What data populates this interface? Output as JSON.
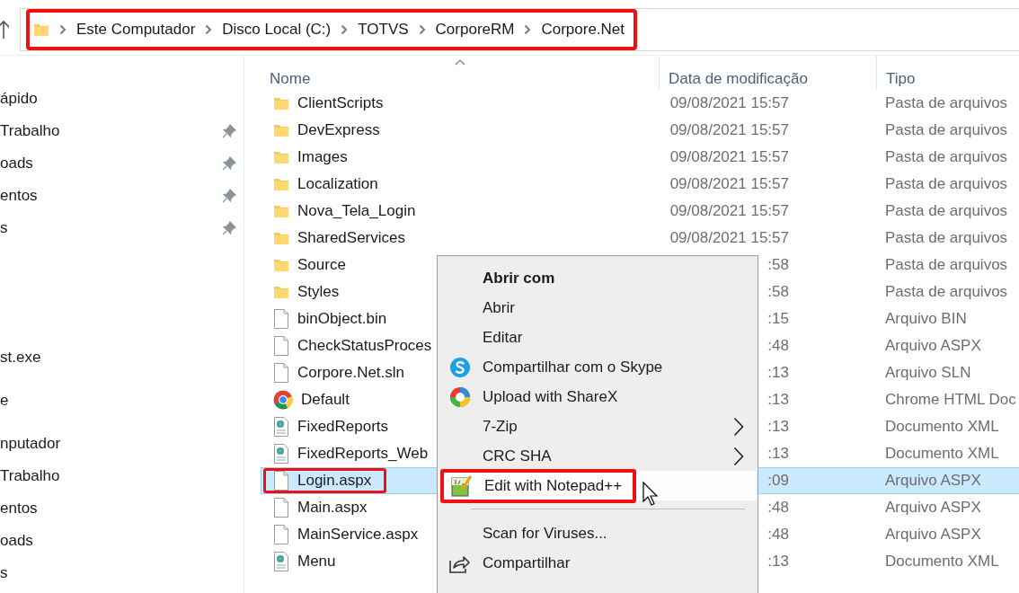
{
  "address_bar": {
    "marked": true,
    "crumbs": [
      "Este Computador",
      "Disco Local (C:)",
      "TOTVS",
      "CorporeRM",
      "Corpore.Net"
    ]
  },
  "sidebar": {
    "groups": [
      {
        "items": [
          {
            "label": "ápido",
            "pinned": false
          },
          {
            "label": "Trabalho",
            "pinned": true
          },
          {
            "label": "oads",
            "pinned": true
          },
          {
            "label": "entos",
            "pinned": true
          },
          {
            "label": "s",
            "pinned": true
          }
        ]
      },
      {
        "items": [
          {
            "label": "st.exe",
            "pinned": false
          }
        ]
      },
      {
        "items": [
          {
            "label": "e",
            "pinned": false
          }
        ]
      },
      {
        "items": [
          {
            "label": "nputador",
            "pinned": false
          },
          {
            "label": "Trabalho",
            "pinned": false
          },
          {
            "label": "entos",
            "pinned": false
          },
          {
            "label": "oads",
            "pinned": false
          },
          {
            "label": "s",
            "pinned": false
          }
        ]
      }
    ]
  },
  "file_list": {
    "columns": [
      "Nome",
      "Data de modificação",
      "Tipo"
    ],
    "rows": [
      {
        "kind": "folder",
        "name": "ClientScripts",
        "date": "09/08/2021 15:57",
        "type": "Pasta de arquivos",
        "selected": false,
        "marked": false
      },
      {
        "kind": "folder",
        "name": "DevExpress",
        "date": "09/08/2021 15:57",
        "type": "Pasta de arquivos",
        "selected": false,
        "marked": false
      },
      {
        "kind": "folder",
        "name": "Images",
        "date": "09/08/2021 15:57",
        "type": "Pasta de arquivos",
        "selected": false,
        "marked": false
      },
      {
        "kind": "folder",
        "name": "Localization",
        "date": "09/08/2021 15:57",
        "type": "Pasta de arquivos",
        "selected": false,
        "marked": false
      },
      {
        "kind": "folder",
        "name": "Nova_Tela_Login",
        "date": "09/08/2021 15:57",
        "type": "Pasta de arquivos",
        "selected": false,
        "marked": false
      },
      {
        "kind": "folder",
        "name": "SharedServices",
        "date": "09/08/2021 15:57",
        "type": "Pasta de arquivos",
        "selected": false,
        "marked": false
      },
      {
        "kind": "folder",
        "name": "Source",
        "date": ":58",
        "type": "Pasta de arquivos",
        "selected": false,
        "marked": false
      },
      {
        "kind": "folder",
        "name": "Styles",
        "date": ":58",
        "type": "Pasta de arquivos",
        "selected": false,
        "marked": false
      },
      {
        "kind": "file",
        "name": "binObject.bin",
        "date": ":15",
        "type": "Arquivo BIN",
        "selected": false,
        "marked": false
      },
      {
        "kind": "file",
        "name": "CheckStatusProces",
        "date": ":48",
        "type": "Arquivo ASPX",
        "selected": false,
        "marked": false
      },
      {
        "kind": "file",
        "name": "Corpore.Net.sln",
        "date": ":13",
        "type": "Arquivo SLN",
        "selected": false,
        "marked": false
      },
      {
        "kind": "chrome",
        "name": "Default",
        "date": ":13",
        "type": "Chrome HTML Doc",
        "selected": false,
        "marked": false
      },
      {
        "kind": "xml",
        "name": "FixedReports",
        "date": ":13",
        "type": "Documento XML",
        "selected": false,
        "marked": false
      },
      {
        "kind": "xml",
        "name": "FixedReports_Web",
        "date": ":13",
        "type": "Documento XML",
        "selected": false,
        "marked": false
      },
      {
        "kind": "file",
        "name": "Login.aspx",
        "date": ":09",
        "type": "Arquivo ASPX",
        "selected": true,
        "marked": true
      },
      {
        "kind": "file",
        "name": "Main.aspx",
        "date": ":48",
        "type": "Arquivo ASPX",
        "selected": false,
        "marked": false
      },
      {
        "kind": "file",
        "name": "MainService.aspx",
        "date": ":48",
        "type": "Arquivo ASPX",
        "selected": false,
        "marked": false
      },
      {
        "kind": "xml",
        "name": "Menu",
        "date": ":13",
        "type": "Documento XML",
        "selected": false,
        "marked": false
      }
    ]
  },
  "context_menu": {
    "items": [
      {
        "kind": "header",
        "label": "Abrir com",
        "selected": false,
        "marked": false
      },
      {
        "kind": "plain",
        "label": "Abrir",
        "selected": false,
        "marked": false
      },
      {
        "kind": "plain",
        "label": "Editar",
        "selected": false,
        "marked": false
      },
      {
        "kind": "skype",
        "label": "Compartilhar com o Skype",
        "selected": false,
        "marked": false
      },
      {
        "kind": "sharex",
        "label": "Upload with ShareX",
        "selected": false,
        "marked": false
      },
      {
        "kind": "submenu",
        "label": "7-Zip",
        "selected": false,
        "marked": false
      },
      {
        "kind": "submenu",
        "label": "CRC SHA",
        "selected": false,
        "marked": false
      },
      {
        "kind": "notepad",
        "label": "Edit with Notepad++",
        "selected": true,
        "marked": true
      },
      {
        "kind": "separator"
      },
      {
        "kind": "plain",
        "label": "Scan for Viruses...",
        "selected": false,
        "marked": false
      },
      {
        "kind": "share",
        "label": "Compartilhar",
        "selected": false,
        "marked": false
      }
    ]
  }
}
